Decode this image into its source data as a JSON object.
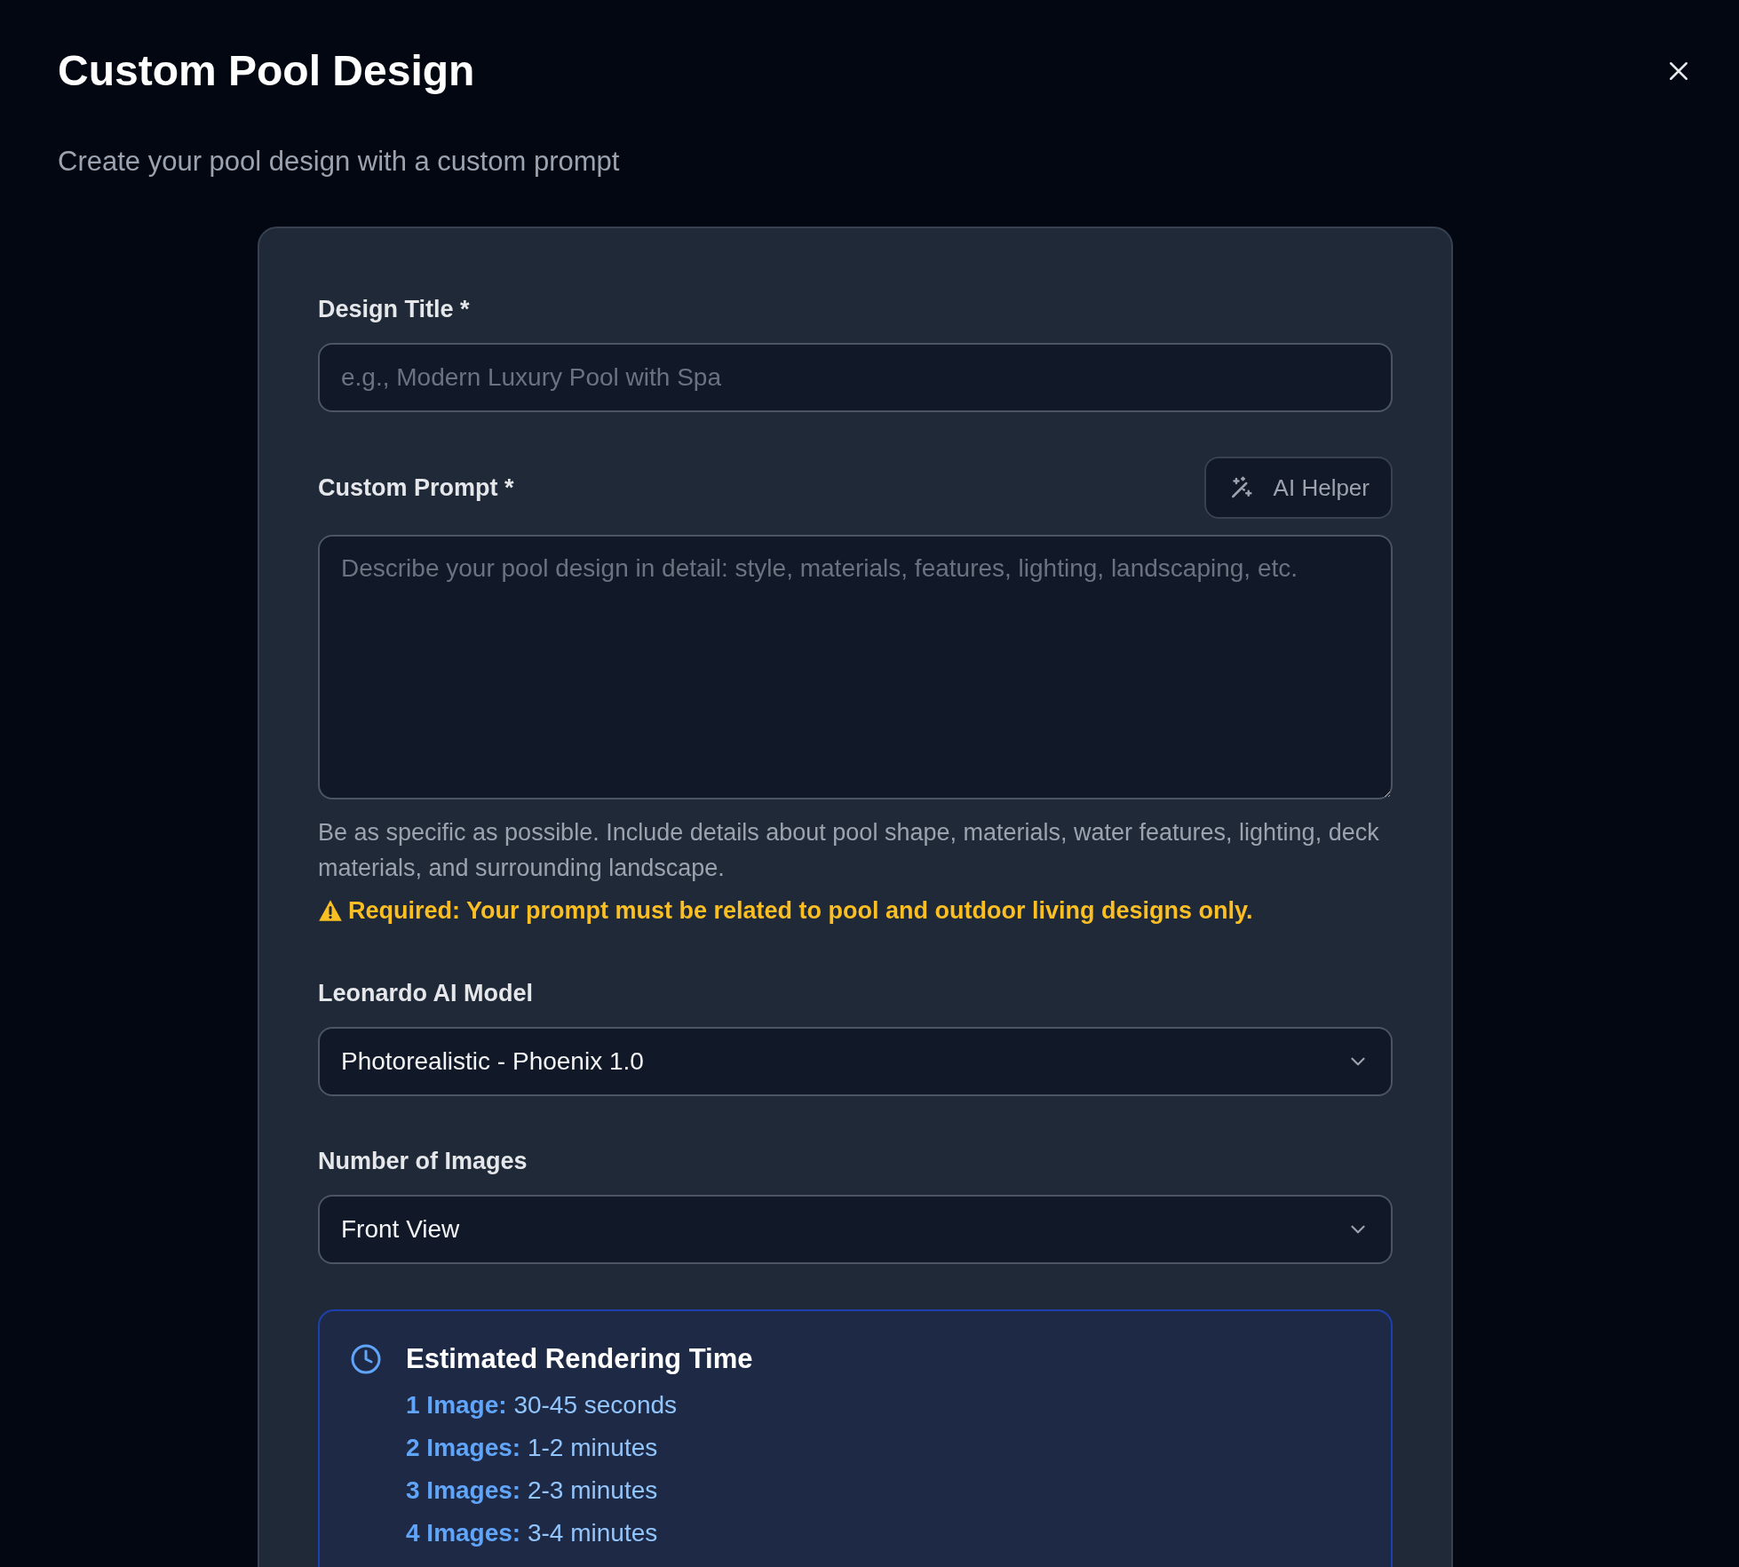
{
  "dialog": {
    "title": "Custom Pool Design",
    "subtitle": "Create your pool design with a custom prompt"
  },
  "form": {
    "design_title": {
      "label": "Design Title *",
      "placeholder": "e.g., Modern Luxury Pool with Spa"
    },
    "custom_prompt": {
      "label": "Custom Prompt *",
      "helper_button": "AI Helper",
      "placeholder": "Describe your pool design in detail: style, materials, features, lighting, landscaping, etc.",
      "hint": "Be as specific as possible. Include details about pool shape, materials, water features, lighting, deck materials, and surrounding landscape.",
      "warning": "Required: Your prompt must be related to pool and outdoor living designs only."
    },
    "model": {
      "label": "Leonardo AI Model",
      "value": "Photorealistic - Phoenix 1.0"
    },
    "image_count": {
      "label": "Number of Images",
      "value": "Front View"
    }
  },
  "rendering_time": {
    "title": "Estimated Rendering Time",
    "items": [
      "**1 Image:** 30-45 seconds",
      "**2 Images:** 1-2 minutes",
      "**3 Images:** 2-3 minutes",
      "**4 Images:** 3-4 minutes"
    ]
  }
}
